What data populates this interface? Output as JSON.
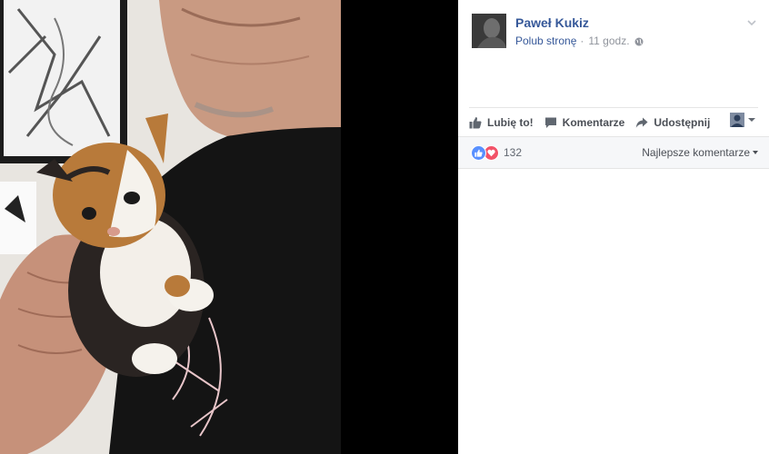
{
  "post": {
    "page_name": "Paweł Kukiz",
    "like_page": "Polub stronę",
    "separator": "·",
    "time": "11 godz.",
    "audience_icon": "globe-icon",
    "menu_icon": "chevron-down-icon"
  },
  "actions": {
    "like": "Lubię to!",
    "comment": "Komentarze",
    "share": "Udostępnij"
  },
  "reactions": {
    "types": [
      "like",
      "love"
    ],
    "count": "132",
    "sort_label": "Najlepsze komentarze"
  },
  "colors": {
    "link_blue": "#365899",
    "like_blue": "#5890ff",
    "love_red": "#f25268",
    "action_gray": "#4b4f56",
    "meta_gray": "#90949c"
  }
}
